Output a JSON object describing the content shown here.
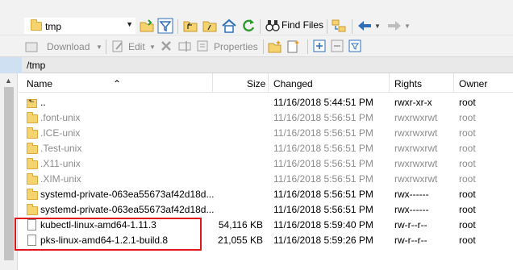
{
  "toolbar_top": {
    "path_value": "tmp",
    "find_files_label": "Find Files"
  },
  "toolbar_bottom": {
    "download_label": "Download",
    "edit_label": "Edit",
    "properties_label": "Properties"
  },
  "path_bar": {
    "path": "/tmp"
  },
  "columns": {
    "name": "Name",
    "size": "Size",
    "changed": "Changed",
    "rights": "Rights",
    "owner": "Owner"
  },
  "rows": [
    {
      "name": "..",
      "size": "",
      "changed": "11/16/2018 5:44:51 PM",
      "rights": "rwxr-xr-x",
      "owner": "root",
      "icon": "parent-folder-icon"
    },
    {
      "name": ".font-unix",
      "size": "",
      "changed": "11/16/2018 5:56:51 PM",
      "rights": "rwxrwxrwt",
      "owner": "root",
      "icon": "folder-icon"
    },
    {
      "name": ".ICE-unix",
      "size": "",
      "changed": "11/16/2018 5:56:51 PM",
      "rights": "rwxrwxrwt",
      "owner": "root",
      "icon": "folder-icon"
    },
    {
      "name": ".Test-unix",
      "size": "",
      "changed": "11/16/2018 5:56:51 PM",
      "rights": "rwxrwxrwt",
      "owner": "root",
      "icon": "folder-icon"
    },
    {
      "name": ".X11-unix",
      "size": "",
      "changed": "11/16/2018 5:56:51 PM",
      "rights": "rwxrwxrwt",
      "owner": "root",
      "icon": "folder-icon"
    },
    {
      "name": ".XIM-unix",
      "size": "",
      "changed": "11/16/2018 5:56:51 PM",
      "rights": "rwxrwxrwt",
      "owner": "root",
      "icon": "folder-icon"
    },
    {
      "name": "systemd-private-063ea55673af42d18d...",
      "size": "",
      "changed": "11/16/2018 5:56:51 PM",
      "rights": "rwx------",
      "owner": "root",
      "icon": "folder-icon"
    },
    {
      "name": "systemd-private-063ea55673af42d18d...",
      "size": "",
      "changed": "11/16/2018 5:56:51 PM",
      "rights": "rwx------",
      "owner": "root",
      "icon": "folder-icon"
    },
    {
      "name": "kubectl-linux-amd64-1.11.3",
      "size": "54,116 KB",
      "changed": "11/16/2018 5:59:40 PM",
      "rights": "rw-r--r--",
      "owner": "root",
      "icon": "file-icon"
    },
    {
      "name": "pks-linux-amd64-1.2.1-build.8",
      "size": "21,055 KB",
      "changed": "11/16/2018 5:59:26 PM",
      "rights": "rw-r--r--",
      "owner": "root",
      "icon": "file-icon"
    }
  ],
  "colors": {
    "highlight": "#e0161d",
    "hidden_text": "#8c8c8c",
    "folder": "#f5d36e"
  }
}
